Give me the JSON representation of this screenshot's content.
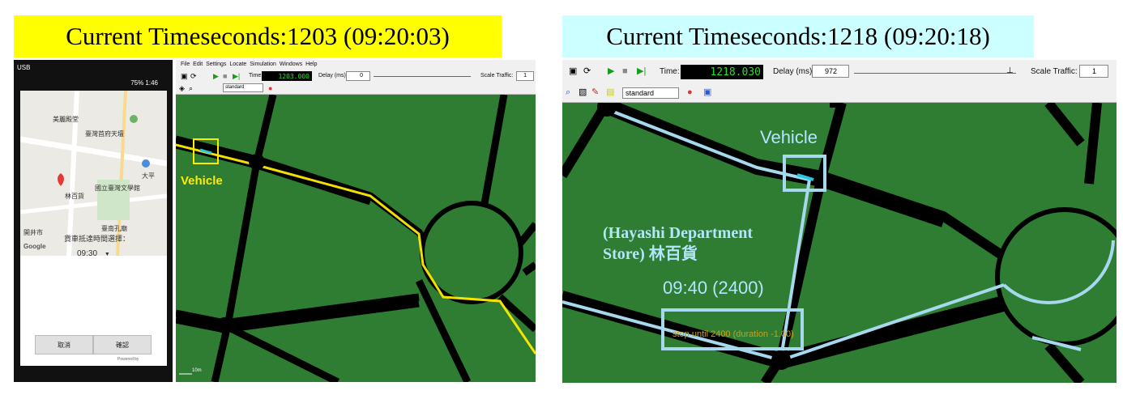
{
  "title_left": "Current Timeseconds:1203 (09:20:03)",
  "title_right": "Current Timeseconds:1218 (09:20:18)",
  "phone": {
    "status_left": "USB",
    "status_right": "75% 1:46",
    "map_labels": [
      "美麗殿堂",
      "臺灣首府天壇",
      "國立臺灣文學館",
      "臺南孔廟",
      "林百貨",
      "大平",
      "開井市",
      "Google"
    ],
    "prompt": "貨車抵達時間選擇：",
    "time_value": "09:30",
    "cancel_label": "取消",
    "confirm_label": "確認",
    "powered": "Powered by"
  },
  "sumo_left": {
    "menu": [
      "File",
      "Edit",
      "Settings",
      "Locate",
      "Simulation",
      "Windows",
      "Help"
    ],
    "time_label": "Time:",
    "time_value": "1203.000",
    "delay_label": "Delay (ms):",
    "delay_value": "0",
    "scale_label": "Scale Traffic:",
    "scale_value": "1",
    "scheme": "standard",
    "annotation": "Vehicle",
    "scale_bar": "10m"
  },
  "sumo_right": {
    "time_label": "Time:",
    "time_value": "1218.030",
    "delay_label": "Delay (ms):",
    "delay_value": "972",
    "scale_label": "Scale Traffic:",
    "scale_value": "1",
    "scheme": "standard",
    "vehicle_label": "Vehicle",
    "store_label": "(Hayashi Department Store) 林百貨",
    "store_line1": "(Hayashi Department",
    "store_line2": "Store) 林百貨",
    "arrival_label": "09:40 (2400)",
    "stop_text": "stop until 2400 (duration -1.00)"
  },
  "colors": {
    "title_left_bg": "#ffff00",
    "title_right_bg": "#ccffff",
    "grass": "#2e7d32",
    "route_left": "#ffeb00",
    "route_right": "#a6d8ee",
    "sim_time": "#23e023"
  }
}
